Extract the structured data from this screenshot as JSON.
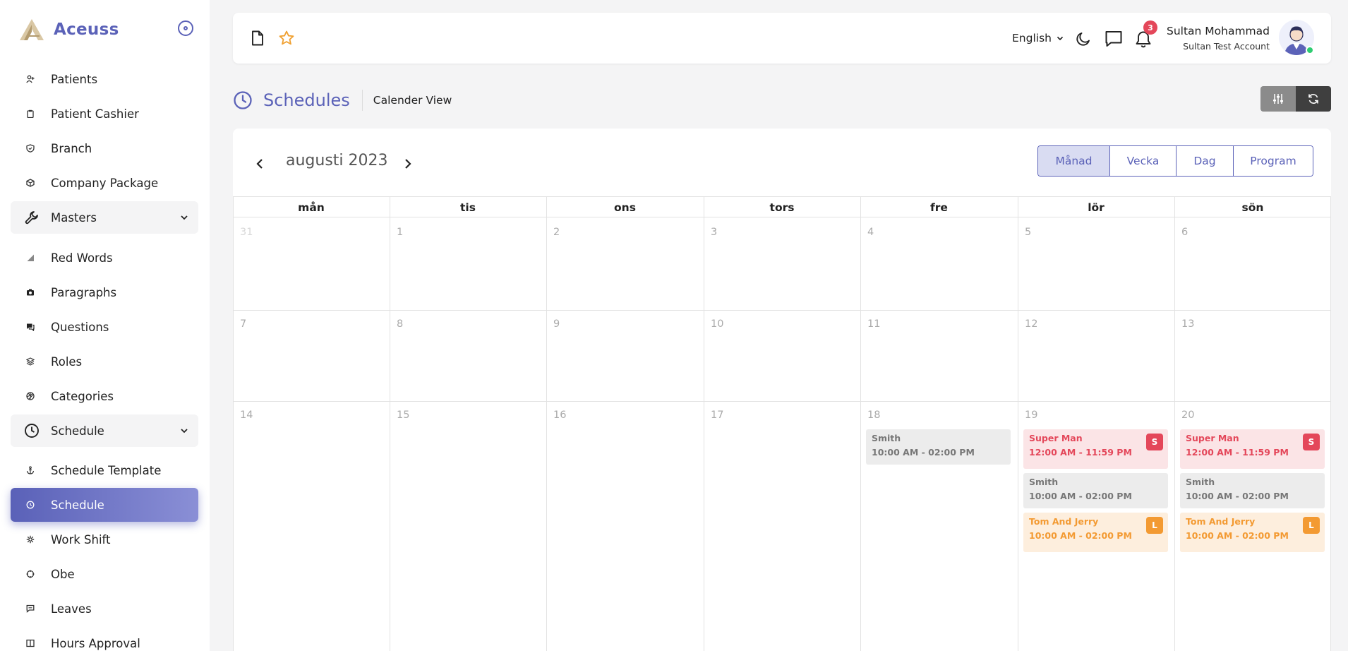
{
  "brand": {
    "name": "Aceuss"
  },
  "sidebar": {
    "items": [
      {
        "label": "Patients",
        "icon": "user-plus-icon"
      },
      {
        "label": "Patient Cashier",
        "icon": "clipboard-icon"
      },
      {
        "label": "Branch",
        "icon": "shield-icon"
      },
      {
        "label": "Company Package",
        "icon": "package-icon"
      },
      {
        "label": "Masters",
        "icon": "wrench-icon"
      },
      {
        "label": "Red Words",
        "icon": "triangle-icon"
      },
      {
        "label": "Paragraphs",
        "icon": "camera-icon"
      },
      {
        "label": "Questions",
        "icon": "chat-icon"
      },
      {
        "label": "Roles",
        "icon": "layers-icon"
      },
      {
        "label": "Categories",
        "icon": "aperture-icon"
      },
      {
        "label": "Schedule",
        "icon": "clock-icon"
      },
      {
        "label": "Schedule Template",
        "icon": "anchor-icon"
      },
      {
        "label": "Schedule",
        "icon": "clock-icon"
      },
      {
        "label": "Work Shift",
        "icon": "cog-icon"
      },
      {
        "label": "Obe",
        "icon": "crosshair-icon"
      },
      {
        "label": "Leaves",
        "icon": "message-icon"
      },
      {
        "label": "Hours Approval",
        "icon": "book-icon"
      }
    ]
  },
  "topbar": {
    "language": "English",
    "notification_count": "3",
    "user_name": "Sultan Mohammad",
    "user_account": "Sultan Test Account"
  },
  "page": {
    "title": "Schedules",
    "subtitle": "Calender View"
  },
  "calendar": {
    "month_label": "augusti 2023",
    "views": [
      "Månad",
      "Vecka",
      "Dag",
      "Program"
    ],
    "active_view": "Månad",
    "weekdays": [
      "mån",
      "tis",
      "ons",
      "tors",
      "fre",
      "lör",
      "sön"
    ],
    "weeks": [
      [
        "31",
        "1",
        "2",
        "3",
        "4",
        "5",
        "6"
      ],
      [
        "7",
        "8",
        "9",
        "10",
        "11",
        "12",
        "13"
      ],
      [
        "14",
        "15",
        "16",
        "17",
        "18",
        "19",
        "20"
      ]
    ],
    "events": {
      "fri18": [
        {
          "title": "Smith",
          "time": "10:00 AM - 02:00 PM"
        }
      ],
      "sat19": [
        {
          "title": "Super Man",
          "time": "12:00 AM - 11:59 PM",
          "tag": "S"
        },
        {
          "title": "Smith",
          "time": "10:00 AM - 02:00 PM"
        },
        {
          "title": "Tom And Jerry",
          "time": "10:00 AM - 02:00 PM",
          "tag": "L"
        }
      ],
      "sun20": [
        {
          "title": "Super Man",
          "time": "12:00 AM - 11:59 PM",
          "tag": "S"
        },
        {
          "title": "Smith",
          "time": "10:00 AM - 02:00 PM"
        },
        {
          "title": "Tom And Jerry",
          "time": "10:00 AM - 02:00 PM",
          "tag": "L"
        }
      ]
    }
  },
  "colors": {
    "accent": "#5b62b8",
    "red": "#e4475a",
    "orange": "#f39a32",
    "grey_event": "#ececec"
  }
}
